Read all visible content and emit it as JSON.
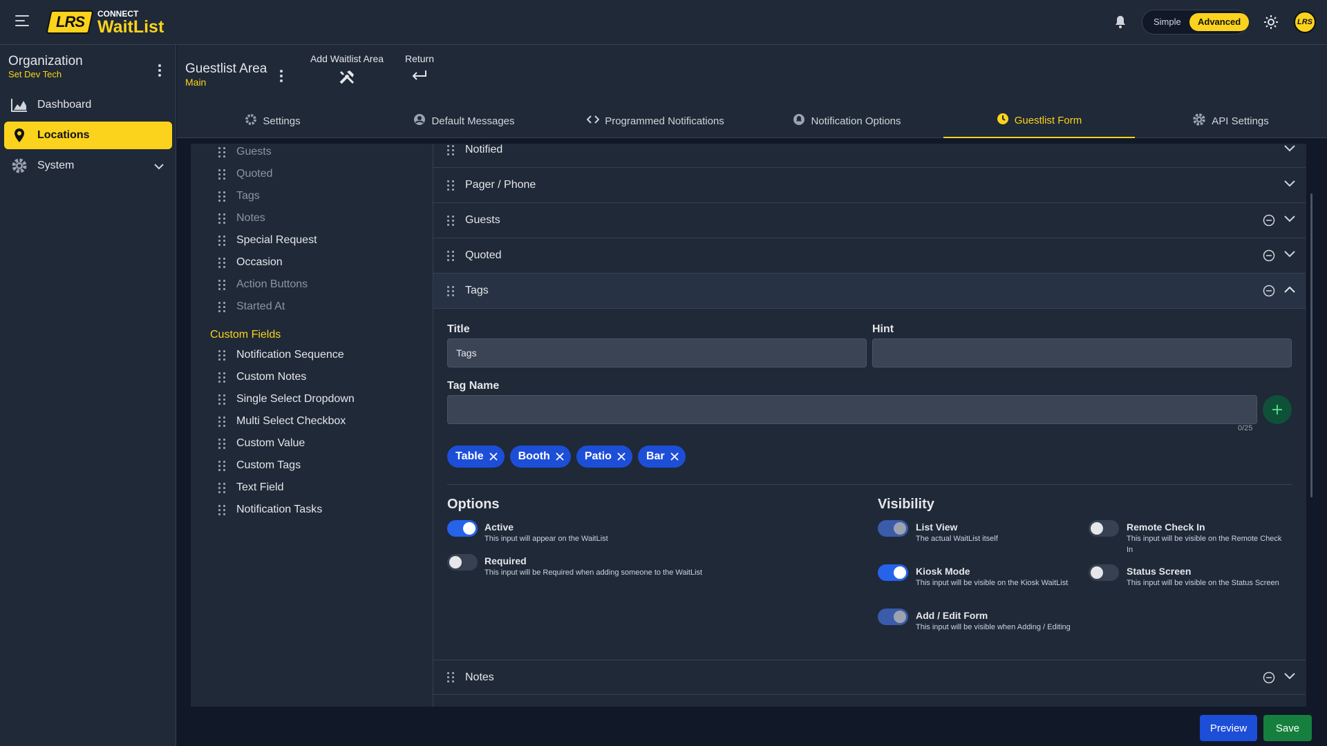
{
  "app": {
    "brand_sup": "CONNECT",
    "brand": "WaitList",
    "logo_text": "LRS",
    "mode_simple": "Simple",
    "mode_advanced": "Advanced",
    "selected_mode": "Advanced"
  },
  "sidebar": {
    "org_title": "Organization",
    "org_sub": "Set Dev Tech",
    "items": [
      {
        "label": "Dashboard",
        "icon": "chart-area-icon"
      },
      {
        "label": "Locations",
        "icon": "map-pin-icon",
        "active": true
      },
      {
        "label": "System",
        "icon": "gear-icon"
      }
    ]
  },
  "header": {
    "title": "Guestlist Area",
    "sub": "Main",
    "add_label": "Add Waitlist Area",
    "return_label": "Return"
  },
  "tabs": [
    "Settings",
    "Default Messages",
    "Programmed Notifications",
    "Notification Options",
    "Guestlist Form",
    "API Settings"
  ],
  "active_tab": "Guestlist Form",
  "fields_list": {
    "standard": [
      "Guests",
      "Quoted",
      "Tags",
      "Notes",
      "Special Request",
      "Occasion",
      "Action Buttons",
      "Started At"
    ],
    "custom_heading": "Custom Fields",
    "custom": [
      "Notification Sequence",
      "Custom Notes",
      "Single Select Dropdown",
      "Multi Select Checkbox",
      "Custom Value",
      "Custom Tags",
      "Text Field",
      "Notification Tasks"
    ]
  },
  "accordion": [
    "Notified",
    "Pager / Phone",
    "Guests",
    "Quoted",
    "Tags",
    "Notes"
  ],
  "tags_panel": {
    "title_label": "Title",
    "title_value": "Tags",
    "hint_label": "Hint",
    "hint_value": "",
    "tag_name_label": "Tag Name",
    "counter": "0/25",
    "chips": [
      "Table",
      "Booth",
      "Patio",
      "Bar"
    ]
  },
  "options": {
    "heading": "Options",
    "items": [
      {
        "title": "Active",
        "desc": "This input will appear on the WaitList",
        "on": true
      },
      {
        "title": "Required",
        "desc": "This input will be Required when adding someone to the WaitList",
        "on": false
      }
    ]
  },
  "visibility": {
    "heading": "Visibility",
    "items": [
      {
        "title": "List View",
        "desc": "The actual WaitList itself",
        "state": "on-disabled"
      },
      {
        "title": "Remote Check In",
        "desc": "This input will be visible on the Remote Check In",
        "state": "off"
      },
      {
        "title": "Kiosk Mode",
        "desc": "This input will be visible on the Kiosk WaitList",
        "state": "on"
      },
      {
        "title": "Status Screen",
        "desc": "This input will be visible on the Status Screen",
        "state": "off"
      },
      {
        "title": "Add / Edit Form",
        "desc": "This input will be visible when Adding / Editing",
        "state": "on-disabled"
      }
    ]
  },
  "footer": {
    "preview": "Preview",
    "save": "Save"
  },
  "colors": {
    "accent": "#fbd31d",
    "primary": "#1d4ed8",
    "success": "#15803d",
    "bg": "#111827",
    "panel": "#1f2937"
  }
}
